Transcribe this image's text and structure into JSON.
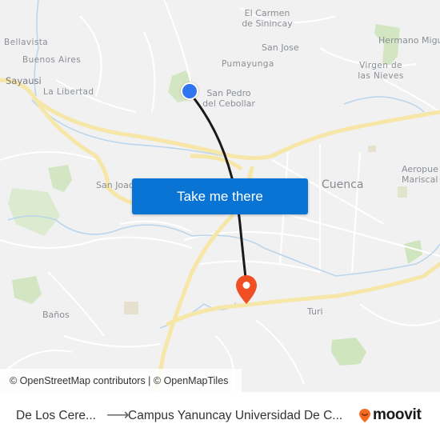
{
  "map": {
    "places": [
      {
        "name": "Bellavista",
        "kind": "small"
      },
      {
        "name": "Buenos Aires",
        "kind": "small"
      },
      {
        "name": "Sayausi",
        "kind": "city"
      },
      {
        "name": "La Libertad",
        "kind": "small"
      },
      {
        "name": "El Carmen de Sinincay",
        "kind": "city"
      },
      {
        "name": "San Jose",
        "kind": "city"
      },
      {
        "name": "Pumayunga",
        "kind": "small"
      },
      {
        "name": "San Pedro del Cebollar",
        "kind": "city"
      },
      {
        "name": "Hermano Migu",
        "kind": "city"
      },
      {
        "name": "Virgen de las Nieves",
        "kind": "small"
      },
      {
        "name": "San Joaq",
        "kind": "city"
      },
      {
        "name": "Cuenca",
        "kind": "big"
      },
      {
        "name": "Aeropue Mariscal L",
        "kind": "city"
      },
      {
        "name": "Baños",
        "kind": "city"
      },
      {
        "name": "Turi",
        "kind": "city"
      }
    ],
    "origin_marker": "origin-dot",
    "destination_marker": "destination-pin",
    "route_color": "#1a1a1a",
    "origin_color": "#2f74f0",
    "destination_color": "#f04e23"
  },
  "cta": {
    "label": "Take me there",
    "color": "#0a74d4"
  },
  "attribution": "© OpenStreetMap contributors | © OpenMapTiles",
  "footer": {
    "from": "De Los Cere...",
    "arrow": "⟶",
    "to": "Campus Yanuncay Universidad De C...",
    "brand": "moovit",
    "brand_color": "#f26b21"
  }
}
